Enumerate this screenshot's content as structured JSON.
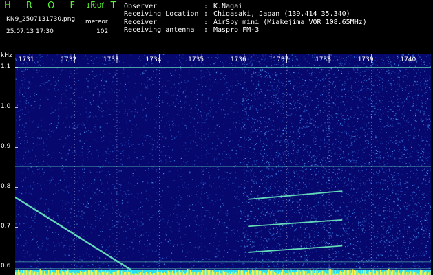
{
  "header": {
    "app_title": "H R O F F T",
    "version": "1.00f",
    "filename": "KN9_2507131730.png",
    "meteor_label": "meteor",
    "datetime": "25.07.13 17:30",
    "meteor_count": "102",
    "info": [
      {
        "key": "Observer",
        "sep": ":",
        "value": "K.Nagai"
      },
      {
        "key": "Receiving Location",
        "sep": ":",
        "value": "Chigasaki, Japan (139.414 35.340)"
      },
      {
        "key": "Receiver",
        "sep": ":",
        "value": "AirSpy mini (Miakejima VOR 108.65MHz)"
      },
      {
        "key": "Receiving antenna",
        "sep": ":",
        "value": "Maspro FM-3"
      }
    ]
  },
  "chart_data": {
    "type": "heatmap",
    "ylabel": "kHz",
    "x_ticks": [
      "1731",
      "1732",
      "1733",
      "1734",
      "1735",
      "1736",
      "1737",
      "1738",
      "1739",
      "1740"
    ],
    "y_ticks": [
      "1.1",
      "1.0",
      "0.9",
      "0.8",
      "0.7",
      "0.6"
    ],
    "x_range": [
      1730.6,
      1740.4
    ],
    "y_range": [
      0.58,
      1.135
    ],
    "horizontal_lines_khz": [
      1.1,
      0.852,
      0.613,
      0.596
    ],
    "meteor_traces": [
      {
        "t": [
          1730.6,
          1733.6
        ],
        "khz": [
          0.775,
          0.575
        ]
      },
      {
        "t": [
          1736.1,
          1738.3
        ],
        "khz": [
          0.77,
          0.79
        ]
      },
      {
        "t": [
          1736.1,
          1738.3
        ],
        "khz": [
          0.702,
          0.718
        ]
      },
      {
        "t": [
          1736.1,
          1738.3
        ],
        "khz": [
          0.637,
          0.653
        ]
      }
    ],
    "colors": {
      "background": "#06086e",
      "noise": "#2f6bd6",
      "signal": "#6ef0c0",
      "baseline": "#f2f24a",
      "baseline_alt": "#29e0f0"
    }
  }
}
